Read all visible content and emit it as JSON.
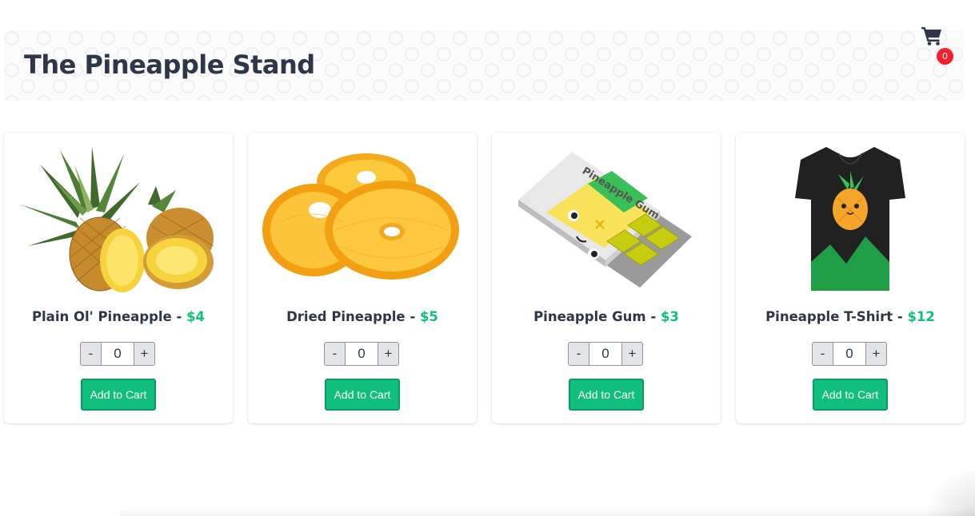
{
  "header": {
    "title": "The Pineapple Stand",
    "cart_icon": "shopping-cart-icon",
    "cart_count": "0"
  },
  "products": [
    {
      "name": "Plain Ol' Pineapple - ",
      "price": "$4",
      "quantity": "0",
      "minus_label": "-",
      "plus_label": "+",
      "button_label": "Add to Cart",
      "image": "whole-pineapple-image"
    },
    {
      "name": "Dried Pineapple - ",
      "price": "$5",
      "quantity": "0",
      "minus_label": "-",
      "plus_label": "+",
      "button_label": "Add to Cart",
      "image": "dried-pineapple-rings-image"
    },
    {
      "name": "Pineapple Gum - ",
      "price": "$3",
      "quantity": "0",
      "minus_label": "-",
      "plus_label": "+",
      "button_label": "Add to Cart",
      "image": "pineapple-gum-pack-image"
    },
    {
      "name": "Pineapple T-Shirt - ",
      "price": "$12",
      "quantity": "0",
      "minus_label": "-",
      "plus_label": "+",
      "button_label": "Add to Cart",
      "image": "pineapple-tshirt-image"
    }
  ],
  "gum_pack_text": "Pineapple Gum",
  "colors": {
    "heading": "#2d3748",
    "price": "#11bf7c",
    "button": "#11bf7c",
    "badge": "#f5222d"
  }
}
